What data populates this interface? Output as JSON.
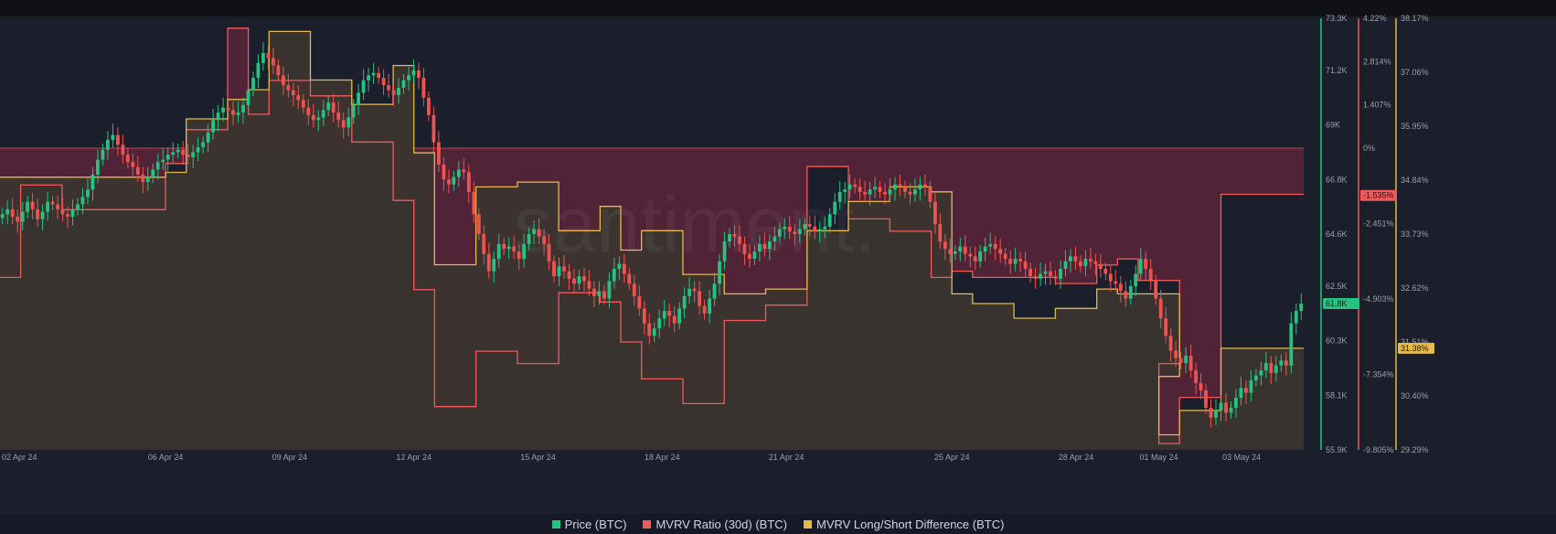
{
  "colors": {
    "background": "#1b1e2b",
    "price": "#26c281",
    "price_down": "#ef5350",
    "mvrv": "#f15a5a",
    "mvrv_fill": "#5a2538",
    "longshort": "#e5b94a",
    "longshort_fill": "#3b3530",
    "grid": "#262a38",
    "tick_text": "#9aa0ad"
  },
  "watermark": "santiment.",
  "legend": [
    {
      "label": "Price (BTC)",
      "color": "#26c281"
    },
    {
      "label": "MVRV Ratio (30d) (BTC)",
      "color": "#f15a5a"
    },
    {
      "label": "MVRV Long/Short Difference (BTC)",
      "color": "#e5b94a"
    }
  ],
  "chart_data": {
    "type": "line",
    "title": "",
    "x_ticks": [
      "02 Apr 24",
      "06 Apr 24",
      "09 Apr 24",
      "12 Apr 24",
      "15 Apr 24",
      "18 Apr 24",
      "21 Apr 24",
      "25 Apr 24",
      "28 Apr 24",
      "01 May 24",
      "03 May 24"
    ],
    "axes": {
      "price": {
        "ticks": [
          "73.3K",
          "71.2K",
          "69K",
          "66.8K",
          "64.6K",
          "62.5K",
          "60.3K",
          "58.1K",
          "55.9K"
        ],
        "ylim": [
          55.9,
          73.3
        ],
        "current": "61.8K"
      },
      "mvrv": {
        "ticks": [
          "4.22%",
          "2.814%",
          "1.407%",
          "0%",
          "-2.451%",
          "-4.903%",
          "-7.354%",
          "-9.805%"
        ],
        "ylim": [
          -9.805,
          4.22
        ],
        "current": "-1.535%"
      },
      "longshort": {
        "ticks": [
          "38.17%",
          "37.06%",
          "35.95%",
          "34.84%",
          "33.73%",
          "32.62%",
          "31.51%",
          "30.40%",
          "29.29%"
        ],
        "ylim": [
          29.29,
          38.17
        ],
        "current": "31.38%"
      }
    },
    "series": [
      {
        "name": "Price (BTC)",
        "kind": "candlestick",
        "unit": "K USD",
        "values": [
          65.4,
          65.6,
          65.3,
          65.1,
          65.5,
          65.9,
          65.6,
          65.2,
          65.5,
          65.9,
          65.8,
          65.6,
          65.4,
          65.3,
          65.6,
          65.8,
          66.1,
          66.4,
          67.0,
          67.6,
          68.0,
          68.4,
          68.6,
          68.2,
          67.8,
          67.5,
          67.3,
          67.0,
          66.7,
          66.9,
          67.2,
          67.5,
          67.6,
          67.8,
          67.9,
          68.0,
          67.8,
          67.7,
          67.9,
          68.1,
          68.3,
          68.7,
          69.2,
          69.5,
          69.7,
          69.6,
          69.4,
          69.5,
          69.8,
          70.4,
          70.9,
          71.5,
          71.9,
          71.7,
          71.4,
          71.0,
          70.6,
          70.4,
          70.2,
          70.0,
          69.7,
          69.4,
          69.2,
          69.3,
          69.6,
          69.9,
          69.5,
          69.2,
          68.9,
          69.3,
          69.8,
          70.3,
          70.8,
          71.0,
          71.1,
          70.9,
          70.6,
          70.4,
          70.2,
          70.5,
          70.8,
          71.0,
          71.2,
          70.9,
          70.1,
          69.4,
          68.3,
          67.4,
          66.8,
          66.6,
          66.9,
          67.2,
          67.1,
          66.3,
          65.4,
          64.6,
          63.8,
          63.1,
          63.6,
          64.2,
          64.0,
          64.1,
          63.9,
          63.6,
          64.2,
          64.6,
          64.8,
          64.5,
          64.2,
          63.5,
          62.9,
          63.3,
          63.1,
          62.8,
          62.6,
          62.9,
          62.7,
          62.4,
          62.1,
          62.3,
          62.0,
          62.7,
          63.2,
          63.4,
          63.0,
          62.6,
          62.1,
          61.6,
          61.0,
          60.5,
          60.8,
          61.2,
          61.5,
          61.3,
          61.0,
          61.6,
          62.1,
          62.4,
          62.3,
          61.7,
          61.4,
          62.0,
          62.6,
          63.5,
          64.3,
          64.6,
          64.5,
          64.2,
          63.8,
          63.6,
          63.9,
          64.2,
          64.0,
          64.3,
          64.5,
          64.8,
          64.9,
          64.7,
          64.6,
          64.8,
          65.0,
          64.9,
          64.7,
          64.8,
          64.9,
          65.4,
          65.9,
          66.3,
          66.4,
          66.6,
          66.5,
          66.3,
          66.2,
          66.4,
          66.5,
          66.3,
          66.2,
          66.4,
          66.6,
          66.5,
          66.3,
          66.2,
          66.4,
          66.6,
          66.5,
          65.9,
          65.0,
          64.3,
          64.0,
          63.8,
          63.9,
          64.1,
          63.8,
          63.7,
          63.5,
          63.9,
          64.1,
          64.2,
          64.0,
          63.8,
          63.6,
          63.4,
          63.6,
          63.5,
          63.2,
          62.9,
          62.8,
          63.0,
          63.1,
          62.9,
          62.8,
          63.2,
          63.5,
          63.7,
          63.5,
          63.3,
          63.6,
          63.5,
          63.4,
          63.2,
          63.0,
          62.7,
          62.6,
          62.3,
          62.0,
          62.5,
          63.0,
          63.6,
          63.2,
          62.7,
          62.0,
          61.2,
          60.5,
          59.9,
          59.6,
          59.4,
          59.7,
          59.1,
          58.6,
          58.3,
          57.6,
          57.2,
          57.5,
          57.8,
          57.4,
          57.6,
          58.0,
          58.4,
          58.2,
          58.7,
          58.9,
          59.1,
          59.4,
          59.0,
          59.3,
          59.5,
          59.3,
          61.0,
          61.5,
          61.8
        ]
      },
      {
        "name": "MVRV Ratio (30d) (BTC)",
        "kind": "step",
        "unit": "%",
        "x_start": [
          "02 Apr 24",
          "02 Apr 24 +12h",
          "03 Apr 24 +12h",
          "06 Apr 24",
          "06 Apr 24 +12h",
          "07 Apr 24 +12h",
          "08 Apr 24",
          "08 Apr 24 +12h",
          "09 Apr 24 +12h",
          "10 Apr 24 +12h",
          "11 Apr 24 +12h",
          "12 Apr 24",
          "12 Apr 24 +12h",
          "13 Apr 24 +12h",
          "14 Apr 24 +12h",
          "15 Apr 24 +12h",
          "16 Apr 24 +12h",
          "17 Apr 24",
          "17 Apr 24 +12h",
          "18 Apr 24 +12h",
          "19 Apr 24 +12h",
          "20 Apr 24 +12h",
          "21 Apr 24 +12h",
          "22 Apr 24 +12h",
          "23 Apr 24 +12h",
          "24 Apr 24 +12h",
          "25 Apr 24",
          "25 Apr 24 +12h",
          "26 Apr 24 +12h",
          "27 Apr 24 +12h",
          "28 Apr 24 +12h",
          "29 Apr 24",
          "29 Apr 24 +12h",
          "30 Apr 24 +12h",
          "01 May 24",
          "01 May 24 +12h",
          "02 May 24 +12h"
        ],
        "values": [
          -4.2,
          -1.2,
          -2.0,
          -0.5,
          0.6,
          3.9,
          1.1,
          2.2,
          1.7,
          0.2,
          -1.7,
          -4.6,
          -8.4,
          -6.6,
          -7.0,
          -4.7,
          -5.0,
          -6.3,
          -7.5,
          -8.3,
          -5.6,
          -5.1,
          -0.6,
          -2.3,
          -2.7,
          -4.2,
          -4.0,
          -4.2,
          -4.2,
          -4.4,
          -3.8,
          -3.6,
          -4.3,
          -7.0,
          -9.6,
          -8.1,
          -1.5
        ]
      },
      {
        "name": "MVRV Long/Short Difference (BTC)",
        "kind": "step",
        "unit": "%",
        "x_start": [
          "02 Apr 24",
          "02 Apr 24 +12h",
          "03 Apr 24 +12h",
          "06 Apr 24",
          "06 Apr 24 +12h",
          "07 Apr 24 +12h",
          "08 Apr 24",
          "08 Apr 24 +12h",
          "09 Apr 24 +12h",
          "10 Apr 24 +12h",
          "11 Apr 24 +12h",
          "12 Apr 24",
          "12 Apr 24 +12h",
          "13 Apr 24 +12h",
          "14 Apr 24 +12h",
          "15 Apr 24 +12h",
          "16 Apr 24 +12h",
          "17 Apr 24",
          "17 Apr 24 +12h",
          "18 Apr 24 +12h",
          "19 Apr 24 +12h",
          "20 Apr 24 +12h",
          "21 Apr 24 +12h",
          "22 Apr 24 +12h",
          "23 Apr 24 +12h",
          "24 Apr 24 +12h",
          "25 Apr 24",
          "25 Apr 24 +12h",
          "26 Apr 24 +12h",
          "27 Apr 24 +12h",
          "28 Apr 24 +12h",
          "29 Apr 24",
          "29 Apr 24 +12h",
          "30 Apr 24 +12h",
          "01 May 24",
          "01 May 24 +12h",
          "02 May 24 +12h"
        ],
        "values": [
          34.9,
          34.9,
          34.9,
          35.0,
          36.1,
          36.5,
          36.7,
          37.9,
          36.9,
          36.4,
          37.2,
          35.4,
          33.1,
          34.7,
          34.8,
          33.8,
          34.3,
          33.4,
          33.8,
          32.9,
          32.5,
          32.6,
          33.8,
          34.4,
          34.7,
          34.6,
          32.5,
          32.3,
          32.0,
          32.2,
          32.6,
          32.5,
          32.5,
          30.8,
          29.6,
          30.1,
          31.38
        ]
      }
    ],
    "grid": false,
    "legend_position": "bottom-center"
  }
}
